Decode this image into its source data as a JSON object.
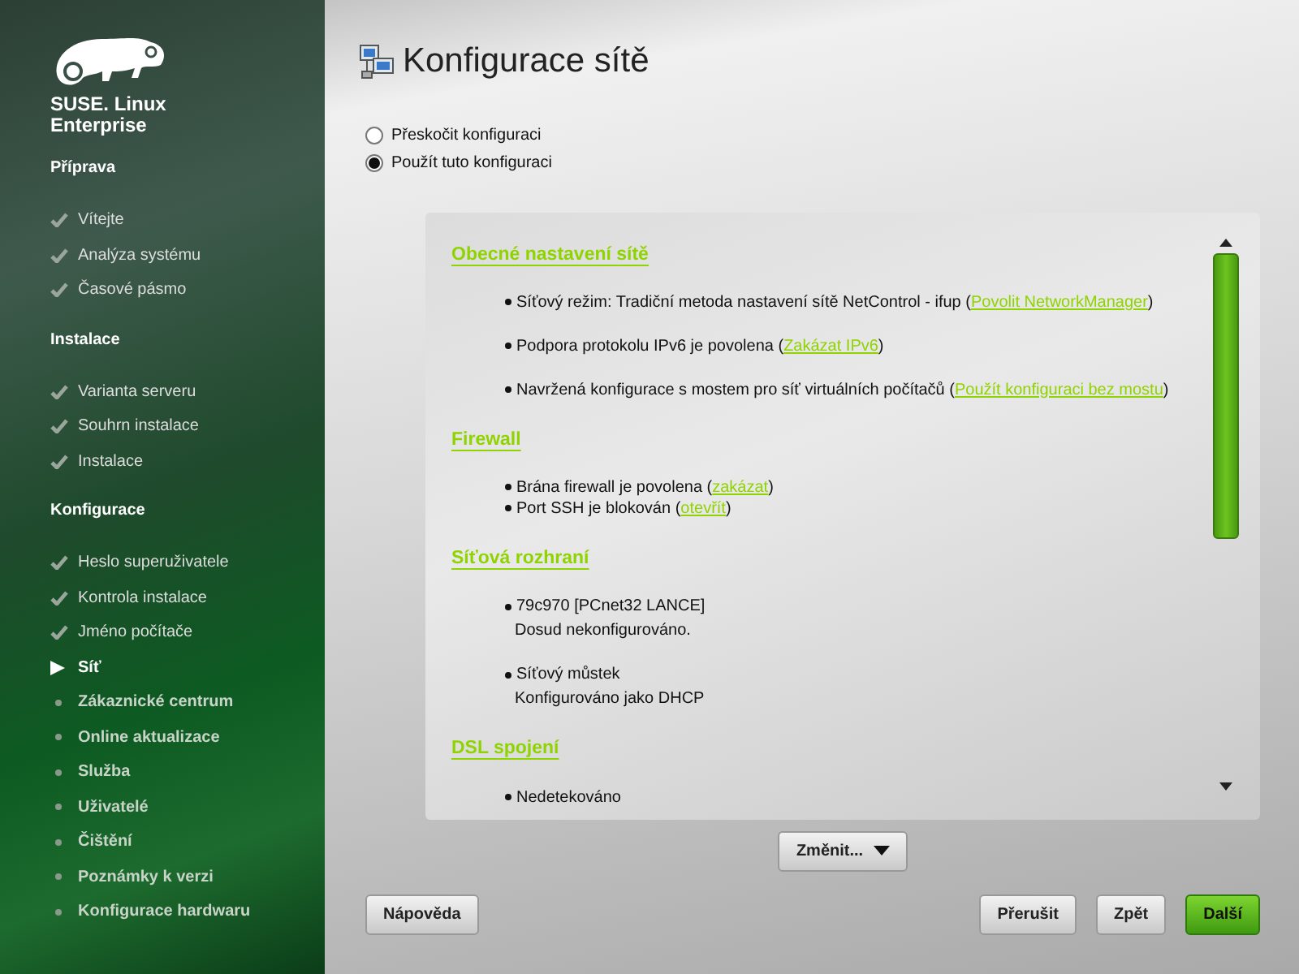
{
  "sidebar": {
    "brand": [
      "SUSE. Linux",
      "Enterprise"
    ],
    "sections": [
      {
        "title": "Příprava",
        "items": [
          {
            "label": "Vítejte",
            "done": true,
            "selected": false
          },
          {
            "label": "Analýza systému",
            "done": true,
            "selected": false
          },
          {
            "label": "Časové pásmo",
            "done": true,
            "selected": false
          }
        ]
      },
      {
        "title": "Instalace",
        "items": [
          {
            "label": "Varianta serveru",
            "done": true,
            "selected": false
          },
          {
            "label": "Souhrn instalace",
            "done": true,
            "selected": false
          },
          {
            "label": "Instalace",
            "done": true,
            "selected": false
          }
        ]
      },
      {
        "title": "Konfigurace",
        "items": [
          {
            "label": "Heslo superuživatele",
            "done": true,
            "selected": false
          },
          {
            "label": "Kontrola instalace",
            "done": true,
            "selected": false
          },
          {
            "label": "Jméno počítače",
            "done": true,
            "selected": false
          },
          {
            "label": "Síť",
            "done": false,
            "selected": true
          },
          {
            "label": "Zákaznické centrum",
            "done": false,
            "selected": false
          },
          {
            "label": "Online aktualizace",
            "done": false,
            "selected": false
          },
          {
            "label": "Služba",
            "done": false,
            "selected": false
          },
          {
            "label": "Uživatelé",
            "done": false,
            "selected": false
          },
          {
            "label": "Čištění",
            "done": false,
            "selected": false
          },
          {
            "label": "Poznámky k verzi",
            "done": false,
            "selected": false
          },
          {
            "label": "Konfigurace hardwaru",
            "done": false,
            "selected": false
          }
        ]
      }
    ]
  },
  "title": "Konfigurace sítě",
  "options": [
    {
      "label": "Přeskočit konfiguraci",
      "selected": false
    },
    {
      "label": "Použít tuto konfiguraci",
      "selected": true
    }
  ],
  "summary": [
    {
      "heading": "Obecné nastavení sítě",
      "spaced": true,
      "bullets": [
        {
          "text": "Síťový režim: Tradiční metoda nastavení sítě NetControl - ifup (",
          "link": "Povolit NetworkManager",
          "after": ")"
        },
        {
          "text": "Podpora protokolu IPv6 je povolena (",
          "link": "Zakázat IPv6",
          "after": ")"
        },
        {
          "text": "Navržená konfigurace s mostem pro síť virtuálních počítačů (",
          "link": "Použít konfiguraci bez mostu",
          "after": ")"
        }
      ]
    },
    {
      "heading": "Firewall",
      "spaced": false,
      "bullets": [
        {
          "text": "Brána firewall je povolena (",
          "link": "zakázat",
          "after": ")"
        },
        {
          "text": "Port SSH je blokován (",
          "link": "otevřít",
          "after": ")"
        }
      ]
    },
    {
      "heading": "Síťová rozhraní",
      "spaced": true,
      "bullets": [
        {
          "text": "79c970 [PCnet32 LANCE]",
          "detail": "Dosud nekonfigurováno."
        },
        {
          "text": "Síťový můstek",
          "detail": "Konfigurováno jako DHCP"
        }
      ]
    },
    {
      "heading": "DSL spojení",
      "bullets": [
        {
          "text": "Nedetekováno"
        }
      ]
    }
  ],
  "change_button": "Změnit...",
  "buttons": [
    {
      "label": "Nápověda",
      "kind": "plain"
    },
    {
      "label": "Přerušit",
      "kind": "plain"
    },
    {
      "label": "Zpět",
      "kind": "plain"
    },
    {
      "label": "Další",
      "kind": "primary"
    }
  ]
}
